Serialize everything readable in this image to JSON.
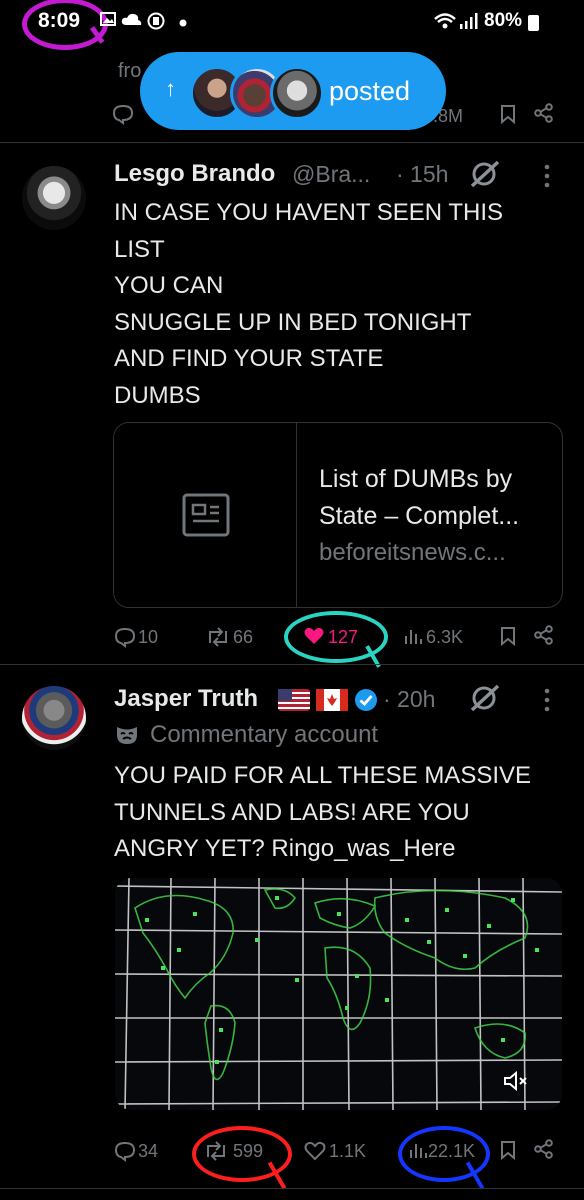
{
  "status_bar": {
    "time": "8:09",
    "battery": "80%"
  },
  "pill": {
    "label": "posted",
    "arrow": "↑"
  },
  "prev_tweet": {
    "fragment": "fro",
    "views": ".8M"
  },
  "tweet1": {
    "name": "Lesgo Brando",
    "handle": "@Bra...",
    "time": "· 15h",
    "lines": [
      "IN CASE YOU HAVENT SEEN THIS",
      "LIST",
      "YOU CAN",
      "SNUGGLE UP IN BED TONIGHT",
      "AND FIND YOUR STATE",
      "DUMBS"
    ],
    "card": {
      "title_line1": "List of DUMBs by",
      "title_line2": "State – Complet...",
      "domain": "beforeitsnews.c..."
    },
    "replies": "10",
    "reposts": "66",
    "likes": "127",
    "views": "6.3K"
  },
  "tweet2": {
    "name": "Jasper Truth",
    "time": "· 20h",
    "label": "Commentary account",
    "lines": [
      "YOU PAID FOR ALL THESE MASSIVE",
      "TUNNELS AND LABS! ARE YOU",
      "ANGRY YET? Ringo_was_Here"
    ],
    "replies": "34",
    "reposts": "599",
    "likes": "1.1K",
    "views": "22.1K"
  },
  "colors": {
    "accent": "#1d9bf0",
    "like": "#f91880",
    "muted": "#71767b",
    "annot_magenta": "#c21bd1",
    "annot_teal": "#2ad4c3",
    "annot_red": "#ff1e1e",
    "annot_blue": "#1436ff"
  },
  "icons": [
    "grok-icon",
    "more-icon",
    "reply-icon",
    "repost-icon",
    "like-icon",
    "views-icon",
    "bookmark-icon",
    "share-icon",
    "article-icon",
    "mute-icon",
    "verified-icon",
    "mask-icon",
    "wifi-icon",
    "signal-icon"
  ]
}
